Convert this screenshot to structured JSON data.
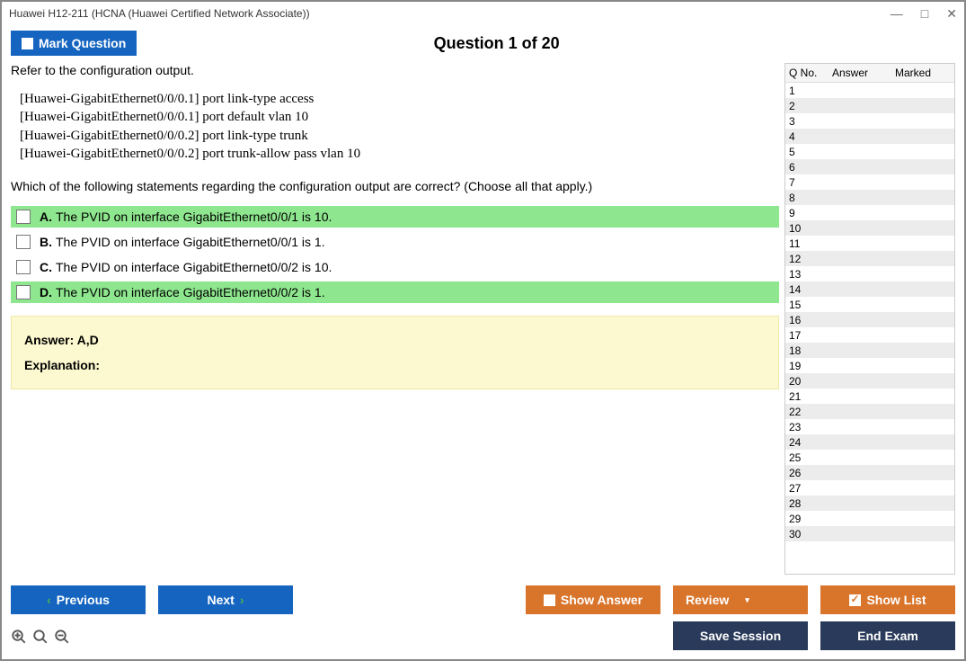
{
  "window": {
    "title": "Huawei H12-211 (HCNA (Huawei Certified Network Associate))"
  },
  "header": {
    "mark_label": "Mark Question",
    "question_title": "Question 1 of 20"
  },
  "question": {
    "intro": "Refer to the configuration output.",
    "config_lines": [
      "[Huawei-GigabitEthernet0/0/0.1] port link-type access",
      "[Huawei-GigabitEthernet0/0/0.1] port default vlan 10",
      "[Huawei-GigabitEthernet0/0/0.2] port link-type trunk",
      "[Huawei-GigabitEthernet0/0/0.2] port trunk-allow pass vlan 10"
    ],
    "prompt": "Which of the following statements regarding the configuration output are correct? (Choose all that apply.)",
    "options": [
      {
        "letter": "A.",
        "text": "The PVID on interface GigabitEthernet0/0/1 is 10.",
        "correct": true
      },
      {
        "letter": "B.",
        "text": "The PVID on interface GigabitEthernet0/0/1 is 1.",
        "correct": false
      },
      {
        "letter": "C.",
        "text": "The PVID on interface GigabitEthernet0/0/2 is 10.",
        "correct": false
      },
      {
        "letter": "D.",
        "text": "The PVID on interface GigabitEthernet0/0/2 is 1.",
        "correct": true
      }
    ],
    "answer_label": "Answer: A,D",
    "explanation_label": "Explanation:"
  },
  "side": {
    "col_qno": "Q No.",
    "col_answer": "Answer",
    "col_marked": "Marked",
    "total_rows": 30
  },
  "footer": {
    "previous": "Previous",
    "next": "Next",
    "show_answer": "Show Answer",
    "review": "Review",
    "show_list": "Show List",
    "save_session": "Save Session",
    "end_exam": "End Exam"
  }
}
